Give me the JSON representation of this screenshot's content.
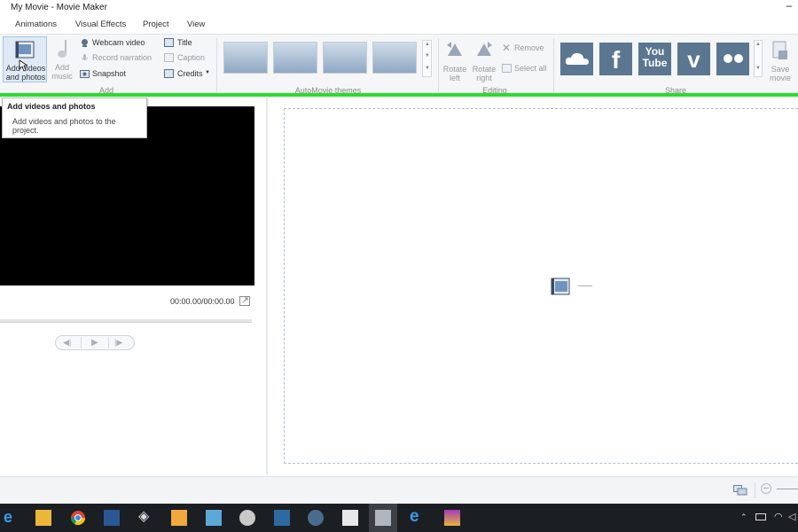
{
  "window": {
    "title": "My Movie - Movie Maker"
  },
  "tabs": [
    "Animations",
    "Visual Effects",
    "Project",
    "View"
  ],
  "ribbon": {
    "add": {
      "group_label": "Add",
      "add_videos_label": "Add videos and photos",
      "add_music_label": "Add music",
      "webcam_label": "Webcam video",
      "narration_label": "Record narration",
      "snapshot_label": "Snapshot",
      "title_label": "Title",
      "caption_label": "Caption",
      "credits_label": "Credits"
    },
    "themes": {
      "group_label": "AutoMovie themes"
    },
    "editing": {
      "group_label": "Editing",
      "rotate_left_label": "Rotate left",
      "rotate_right_label": "Rotate right",
      "remove_label": "Remove",
      "select_all_label": "Select all"
    },
    "share": {
      "group_label": "Share",
      "save_movie_label": "Save movie",
      "services": [
        "onedrive-icon",
        "facebook-icon",
        "youtube-icon",
        "vimeo-icon",
        "flickr-icon"
      ],
      "youtube_text": "You Tube",
      "facebook_text": "f",
      "vimeo_text": "v"
    }
  },
  "tooltip": {
    "title": "Add videos and photos",
    "body": "Add videos and photos to the project."
  },
  "preview": {
    "timecode": "00:00.00/00:00.00"
  },
  "colors": {
    "highlight": "#2adc2a",
    "share_tile": "#5b7690",
    "taskbar": "#1b1e22"
  },
  "taskbar": {
    "apps": [
      "edge-icon",
      "file-explorer-icon",
      "chrome-icon",
      "word-icon",
      "gem-app-icon",
      "media-player-icon",
      "photos-icon",
      "paint-icon",
      "terminal-icon",
      "steam-icon",
      "store-icon",
      "movie-maker-icon",
      "internet-explorer-icon",
      "winrar-icon"
    ]
  }
}
